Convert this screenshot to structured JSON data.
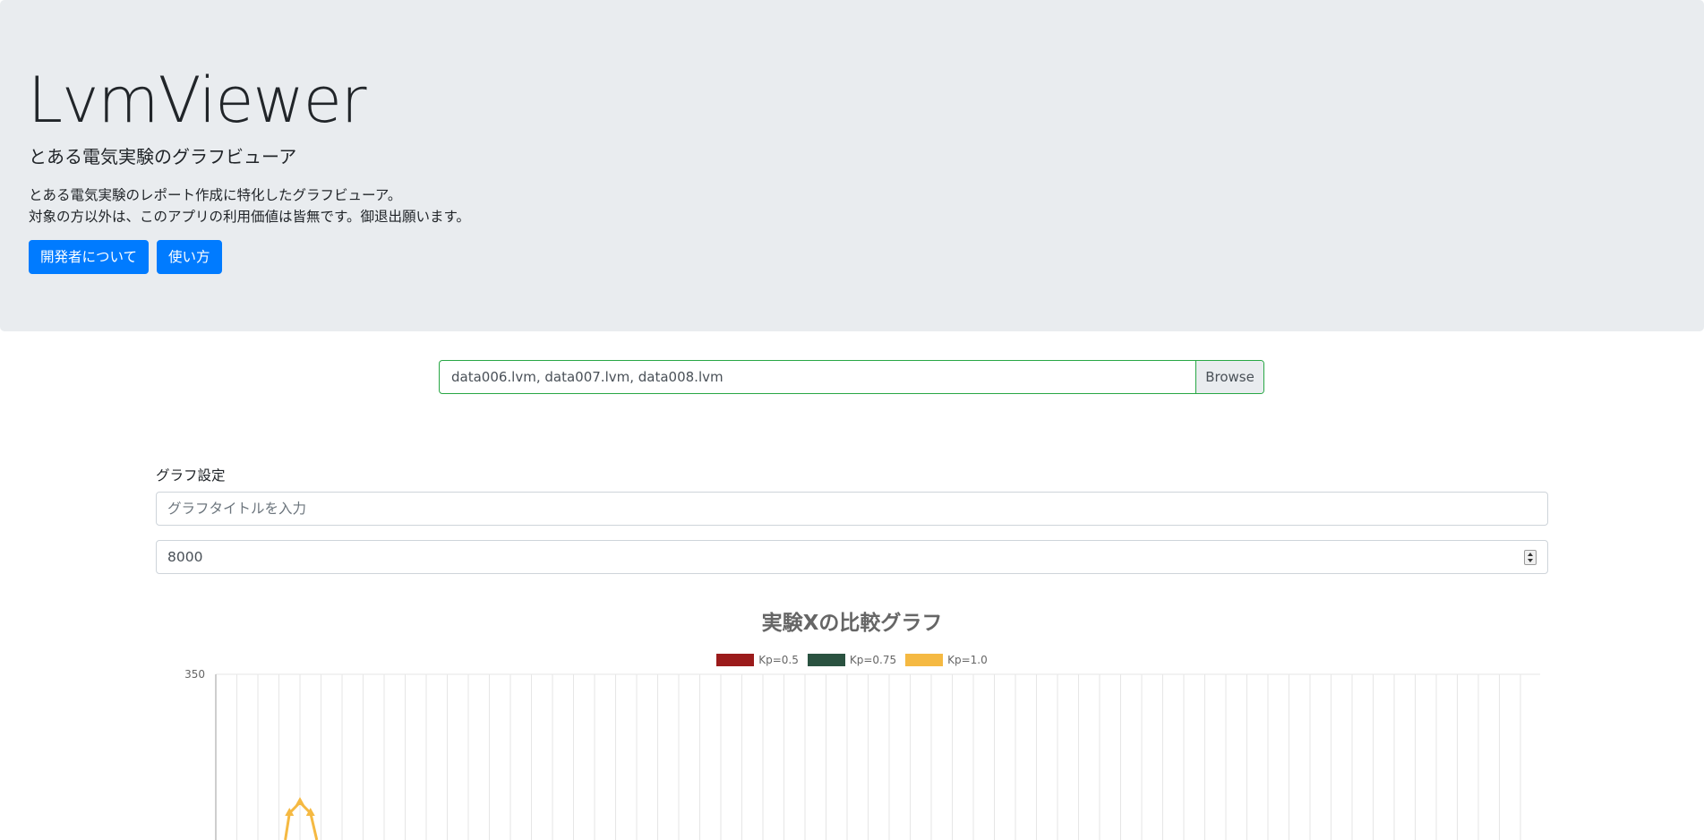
{
  "header": {
    "title": "LvmViewer",
    "subtitle": "とある電気実験のグラフビューア",
    "description_line1": "とある電気実験のレポート作成に特化したグラフビューア。",
    "description_line2": "対象の方以外は、このアプリの利用価値は皆無です。御退出願います。",
    "about_button": "開発者について",
    "usage_button": "使い方"
  },
  "file_input": {
    "value": "data006.lvm, data007.lvm, data008.lvm",
    "browse_label": "Browse"
  },
  "settings": {
    "label": "グラフ設定",
    "title_placeholder": "グラフタイトルを入力",
    "number_value": "8000"
  },
  "colors": {
    "primary": "#007bff",
    "jumbotron_bg": "#e9ecef",
    "valid_border": "#28a745",
    "series_kp05": "#9b1b1b",
    "series_kp075": "#2a5240",
    "series_kp10": "#f5b942"
  },
  "chart_data": {
    "type": "line",
    "title": "実験Xの比較グラフ",
    "ylim_top": 350,
    "y_tick_labels": [
      "350"
    ],
    "grid": true,
    "legend_position": "top-center",
    "series": [
      {
        "name": "Kp=0.5",
        "color": "#9b1b1b",
        "points": []
      },
      {
        "name": "Kp=0.75",
        "color": "#2a5240",
        "points": []
      },
      {
        "name": "Kp=1.0",
        "color": "#f5b942",
        "points": [
          {
            "x": 3.3,
            "y": 0
          },
          {
            "x": 3.5,
            "y": 30
          },
          {
            "x": 4.0,
            "y": 42
          },
          {
            "x": 4.5,
            "y": 30
          },
          {
            "x": 4.8,
            "y": 0
          }
        ]
      }
    ]
  }
}
